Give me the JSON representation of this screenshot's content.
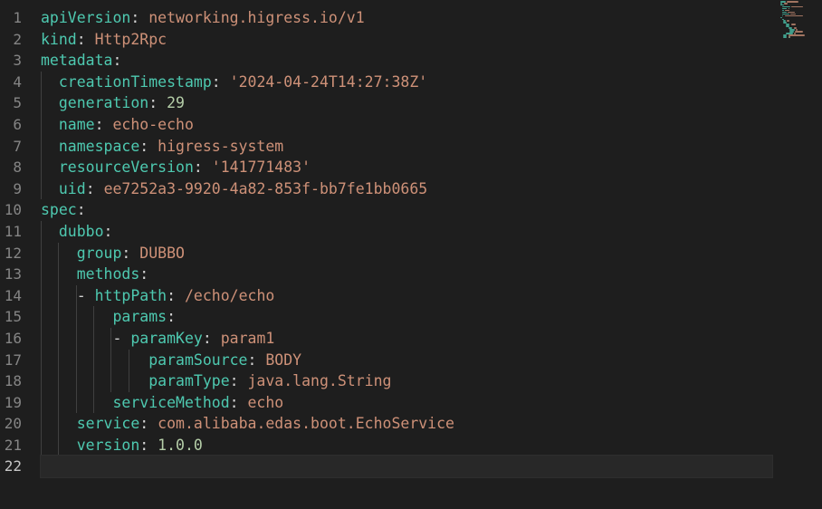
{
  "editor": {
    "active_line": 22,
    "lines": [
      {
        "number": "1",
        "indent": 0,
        "key": "apiVersion",
        "sep": ": ",
        "value": "networking.higress.io/v1",
        "vtype": "v"
      },
      {
        "number": "2",
        "indent": 0,
        "key": "kind",
        "sep": ": ",
        "value": "Http2Rpc",
        "vtype": "v"
      },
      {
        "number": "3",
        "indent": 0,
        "key": "metadata",
        "sep": ":",
        "value": "",
        "vtype": "v"
      },
      {
        "number": "4",
        "indent": 1,
        "key": "creationTimestamp",
        "sep": ": ",
        "value": "'2024-04-24T14:27:38Z'",
        "vtype": "v"
      },
      {
        "number": "5",
        "indent": 1,
        "key": "generation",
        "sep": ": ",
        "value": "29",
        "vtype": "n"
      },
      {
        "number": "6",
        "indent": 1,
        "key": "name",
        "sep": ": ",
        "value": "echo-echo",
        "vtype": "v"
      },
      {
        "number": "7",
        "indent": 1,
        "key": "namespace",
        "sep": ": ",
        "value": "higress-system",
        "vtype": "v"
      },
      {
        "number": "8",
        "indent": 1,
        "key": "resourceVersion",
        "sep": ": ",
        "value": "'141771483'",
        "vtype": "v"
      },
      {
        "number": "9",
        "indent": 1,
        "key": "uid",
        "sep": ": ",
        "value": "ee7252a3-9920-4a82-853f-bb7fe1bb0665",
        "vtype": "v"
      },
      {
        "number": "10",
        "indent": 0,
        "key": "spec",
        "sep": ":",
        "value": "",
        "vtype": "v"
      },
      {
        "number": "11",
        "indent": 1,
        "key": "dubbo",
        "sep": ":",
        "value": "",
        "vtype": "v"
      },
      {
        "number": "12",
        "indent": 2,
        "key": "group",
        "sep": ": ",
        "value": "DUBBO",
        "vtype": "v"
      },
      {
        "number": "13",
        "indent": 2,
        "key": "methods",
        "sep": ":",
        "value": "",
        "vtype": "v"
      },
      {
        "number": "14",
        "indent": 3,
        "dash": true,
        "key": "httpPath",
        "sep": ": ",
        "value": "/echo/echo",
        "vtype": "v"
      },
      {
        "number": "15",
        "indent": 4,
        "key": "params",
        "sep": ":",
        "value": "",
        "vtype": "v"
      },
      {
        "number": "16",
        "indent": 5,
        "dash": true,
        "key": "paramKey",
        "sep": ": ",
        "value": "param1",
        "vtype": "v"
      },
      {
        "number": "17",
        "indent": 6,
        "key": "paramSource",
        "sep": ": ",
        "value": "BODY",
        "vtype": "v"
      },
      {
        "number": "18",
        "indent": 6,
        "key": "paramType",
        "sep": ": ",
        "value": "java.lang.String",
        "vtype": "v"
      },
      {
        "number": "19",
        "indent": 4,
        "key": "serviceMethod",
        "sep": ": ",
        "value": "echo",
        "vtype": "v"
      },
      {
        "number": "20",
        "indent": 2,
        "key": "service",
        "sep": ": ",
        "value": "com.alibaba.edas.boot.EchoService",
        "vtype": "v"
      },
      {
        "number": "21",
        "indent": 2,
        "key": "version",
        "sep": ": ",
        "value": "1.0.0",
        "vtype": "n"
      },
      {
        "number": "22",
        "indent": 0,
        "key": "",
        "sep": "",
        "value": "",
        "vtype": "v"
      }
    ]
  },
  "colors": {
    "background": "#1e1e1e",
    "key": "#4ec9b0",
    "string": "#ce9178",
    "number": "#b5cea8",
    "punctuation": "#d4d4d4",
    "line_number": "#858585",
    "indent_guide": "#404040"
  }
}
